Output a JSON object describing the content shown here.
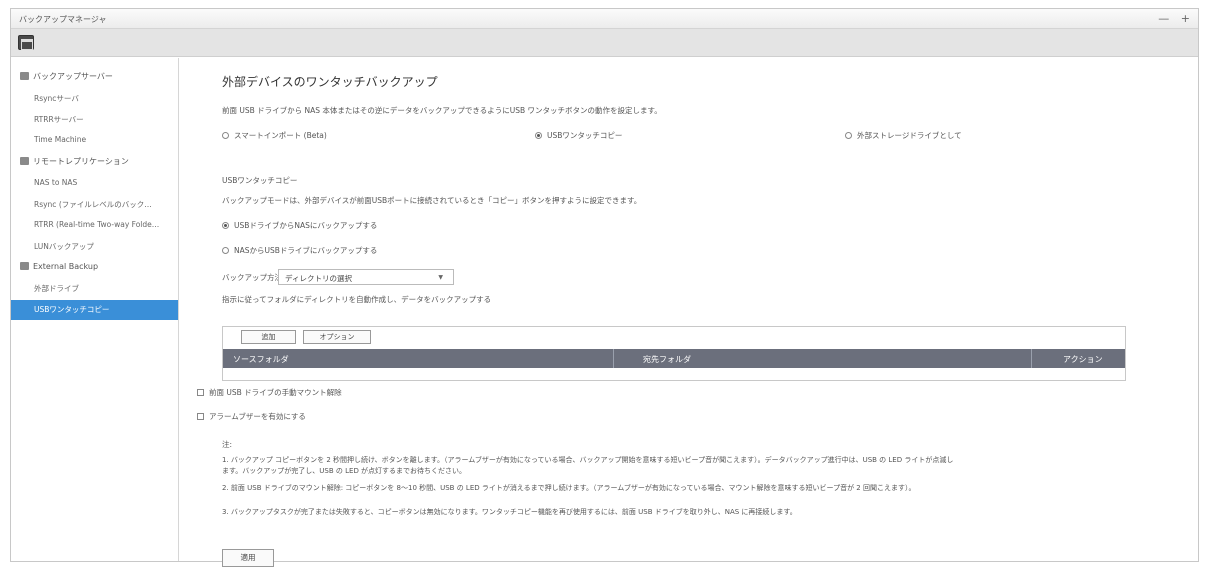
{
  "window": {
    "title": "バックアップマネージャ",
    "controls": [
      "—",
      "+"
    ]
  },
  "sidebar": {
    "groups": [
      {
        "label": "バックアップサーバー",
        "items": [
          "Rsyncサーバ",
          "RTRRサーバー",
          "Time Machine"
        ]
      },
      {
        "label": "リモートレプリケーション",
        "items": [
          "NAS to NAS",
          "Rsync (ファイルレベルのバック…",
          "RTRR (Real-time Two-way Folde…",
          "LUNバックアップ"
        ]
      },
      {
        "label": "External Backup",
        "items": [
          "外部ドライブ",
          "USBワンタッチコピー"
        ]
      }
    ],
    "active_item": "USBワンタッチコピー"
  },
  "main": {
    "title": "外部デバイスのワンタッチバックアップ",
    "description": "前面 USB ドライブから NAS 本体またはその逆にデータをバックアップできるようにUSB ワンタッチボタンの動作を設定します。",
    "mode_options": [
      {
        "label": "スマートインポート (Beta)",
        "selected": false
      },
      {
        "label": "USBワンタッチコピー",
        "selected": true
      },
      {
        "label": "外部ストレージドライブとして",
        "selected": false
      }
    ],
    "section_title": "USBワンタッチコピー",
    "section_desc": "バックアップモードは、外部デバイスが前面USBポートに接続されているとき「コピー」ボタンを押すように設定できます。",
    "direction_options": [
      {
        "label": "USBドライブからNASにバックアップする",
        "selected": true
      },
      {
        "label": "NASからUSBドライブにバックアップする",
        "selected": false
      }
    ],
    "method_label": "バックアップ方法:",
    "method_value": "ディレクトリの選択",
    "method_desc": "指示に従ってフォルダにディレクトリを自動作成し、データをバックアップする",
    "table": {
      "buttons": [
        "追加",
        "オプション"
      ],
      "columns": [
        "ソースフォルダ",
        "宛先フォルダ",
        "アクション"
      ]
    },
    "checkbox_unmount": "前面 USB ドライブの手動マウント解除",
    "checkbox_buzzer": "アラームブザーを有効にする",
    "note_heading": "注:",
    "notes": [
      "1. バックアップ コピーボタンを 2 秒間押し続け、ボタンを離します。（アラームブザーが有効になっている場合、バックアップ開始を意味する短いビープ音が聞こえます）。データバックアップ進行中は、USB の LED ライトが点滅し",
      "ます。バックアップが完了し、USB の LED が点灯するまでお待ちください。",
      "2. 前面 USB ドライブのマウント解除: コピーボタンを 8～10 秒間、USB の LED ライトが消えるまで押し続けます。（アラームブザーが有効になっている場合、マウント解除を意味する短いビープ音が 2 回聞こえます）。",
      "3. バックアップタスクが完了または失敗すると、コピーボタンは無効になります。ワンタッチコピー機能を再び使用するには、前面 USB ドライブを取り外し、NAS に再接続します。"
    ],
    "apply_label": "適用"
  }
}
